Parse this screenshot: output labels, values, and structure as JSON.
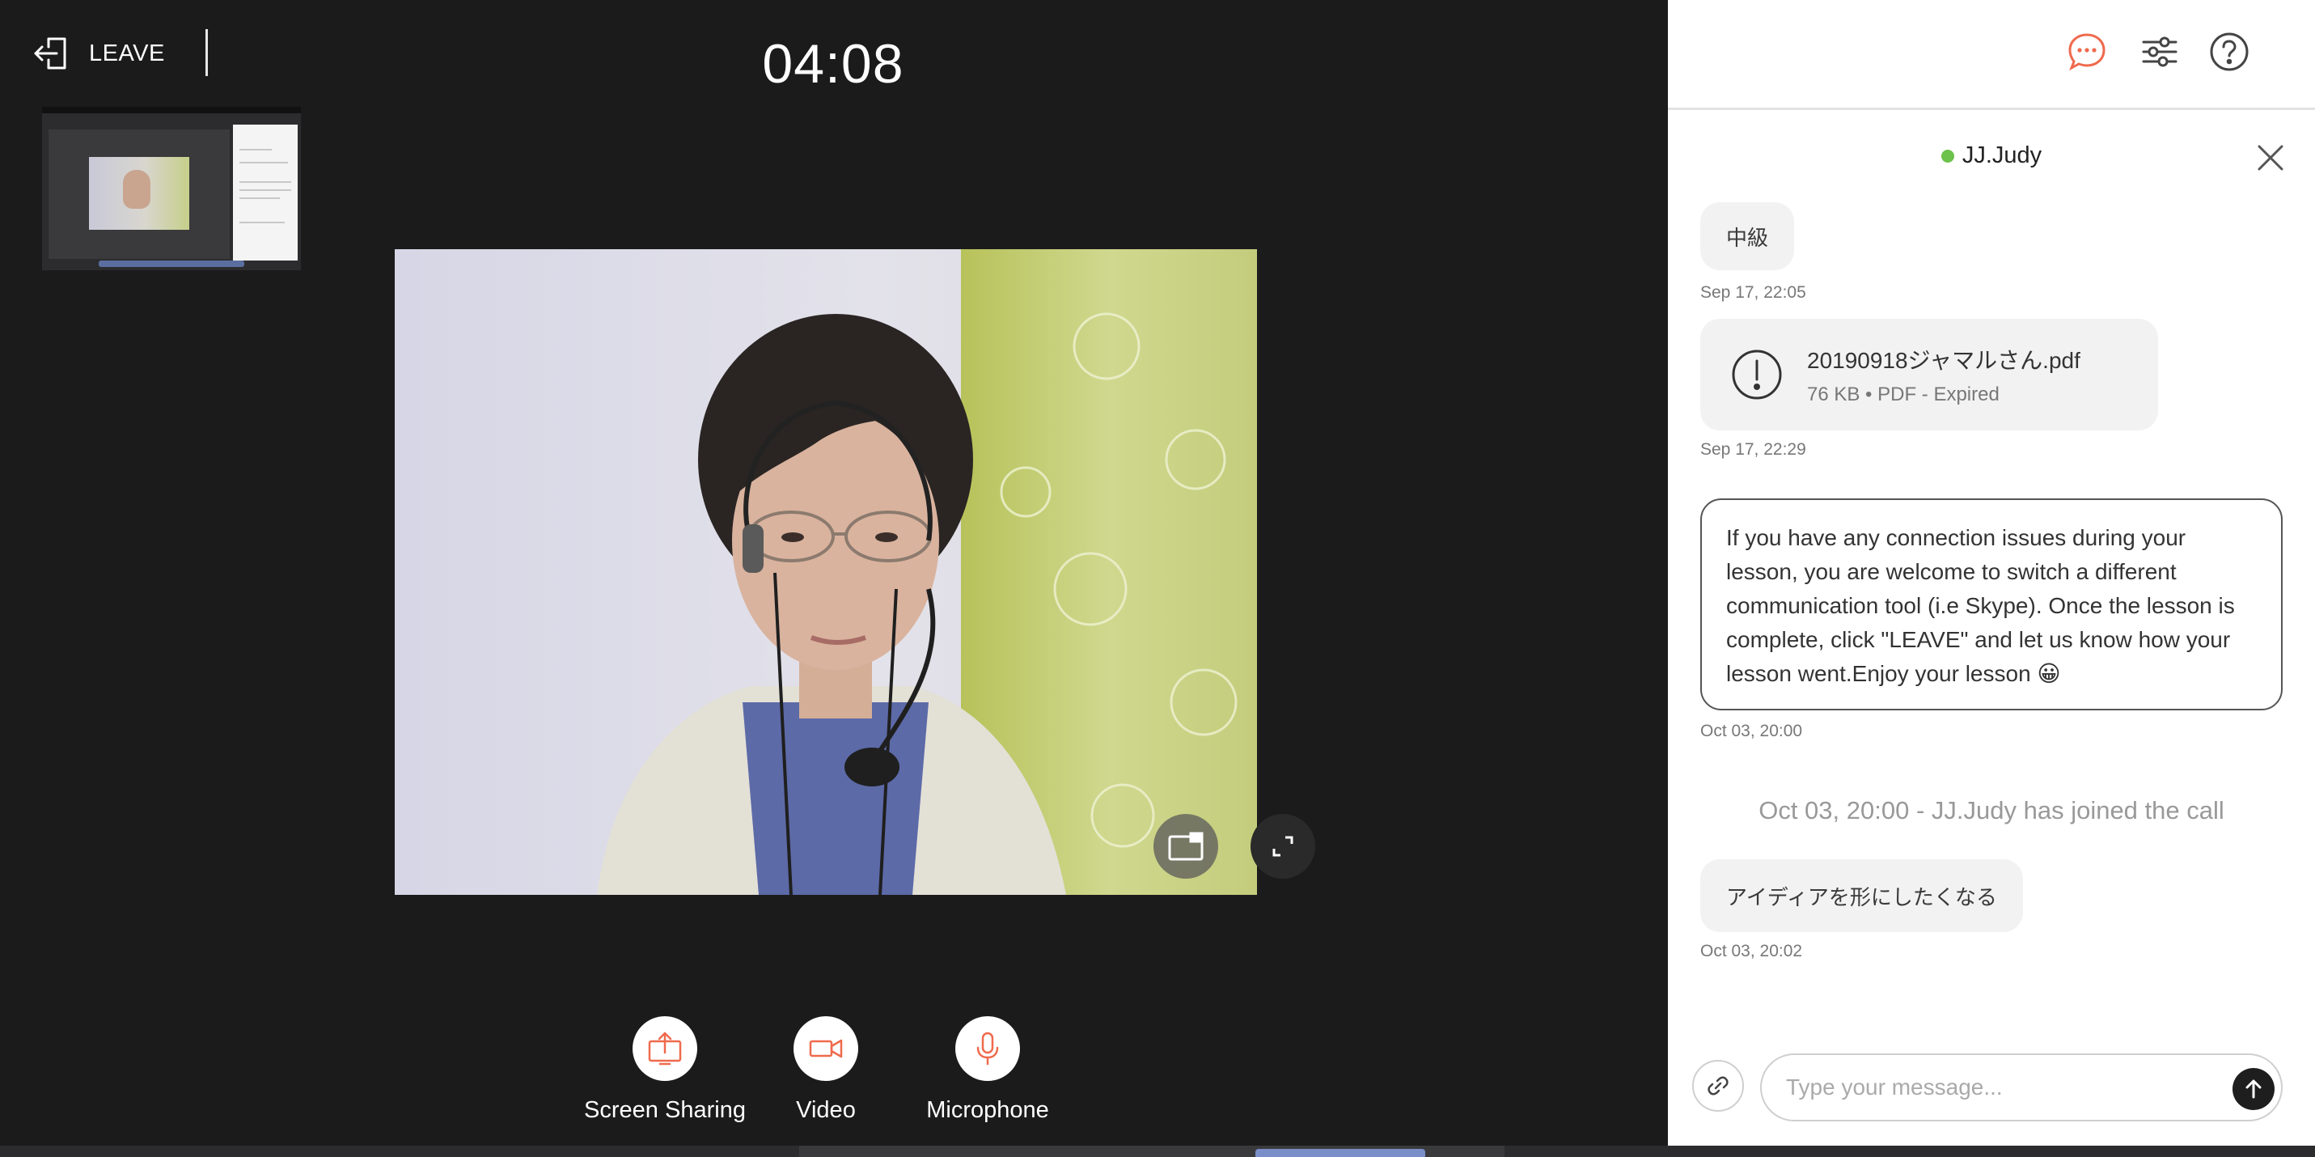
{
  "toolbar": {
    "leave_label": "LEAVE",
    "timer": "04:08"
  },
  "controls": {
    "screen_sharing": {
      "label": "Screen Sharing",
      "icon": "screen-share-icon"
    },
    "video": {
      "label": "Video",
      "icon": "video-camera-icon"
    },
    "microphone": {
      "label": "Microphone",
      "icon": "microphone-icon"
    }
  },
  "chat": {
    "contact_name": "JJ.Judy",
    "contact_status": "online",
    "messages": [
      {
        "text": "中級",
        "timestamp": "Sep 17, 22:05"
      },
      {
        "file_name": "20190918ジャマルさん.pdf",
        "file_meta": "76 KB • PDF - Expired",
        "timestamp": "Sep 17, 22:29"
      },
      {
        "text": "If you have any connection issues during your lesson, you are welcome to switch a different communication tool (i.e Skype). Once the lesson is complete, click \"LEAVE\" and let us know how your lesson went.Enjoy your lesson 😀",
        "timestamp": "Oct 03, 20:00"
      },
      {
        "text": "Oct 03, 20:00 - JJ.Judy has joined the call"
      },
      {
        "text": "アイディアを形にしたくなる",
        "timestamp": "Oct 03, 20:02"
      }
    ],
    "input_placeholder": "Type your message..."
  },
  "colors": {
    "accent": "#ef6a4d",
    "online": "#6cc24a",
    "call_background": "#1c1b1c",
    "bubble": "#f2f2f2"
  }
}
